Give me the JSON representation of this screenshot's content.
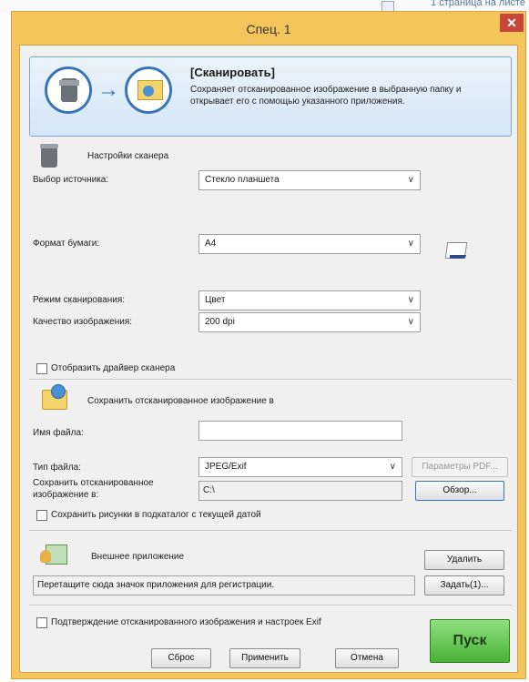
{
  "background": {
    "text": "1 страница на листе"
  },
  "window": {
    "title": "Спец. 1",
    "close_glyph": "✕"
  },
  "banner": {
    "title": "[Сканировать]",
    "description": "Сохраняет отсканированное изображение в выбранную папку и открывает его с помощью указанного приложения.",
    "arrow_glyph": "→"
  },
  "scanner_settings": {
    "section_label": "Настройки сканера",
    "source_label": "Выбор источника:",
    "source_value": "Стекло планшета",
    "paper_label": "Формат бумаги:",
    "paper_value": "A4",
    "mode_label": "Режим сканирования:",
    "mode_value": "Цвет",
    "quality_label": "Качество изображения:",
    "quality_value": "200 dpi",
    "show_driver_label": "Отобразить драйвер сканера"
  },
  "save": {
    "section_label": "Сохранить отсканированное изображение в",
    "filename_label": "Имя файла:",
    "filename_value": "",
    "filetype_label": "Тип файла:",
    "filetype_value": "JPEG/Exif",
    "pdf_params_button": "Параметры PDF...",
    "save_to_label": "Сохранить отсканированное изображение в:",
    "save_to_value": "C:\\",
    "browse_button": "Обзор...",
    "subfolder_label": "Сохранить рисунки в подкаталог с текущей датой"
  },
  "external_app": {
    "section_label": "Внешнее приложение",
    "remove_button": "Удалить",
    "hint": "Перетащите сюда значок приложения для регистрации.",
    "set_button": "Задать(1)..."
  },
  "footer": {
    "confirm_label": "Подтверждение отсканированного изображения и настроек Exif",
    "reset_button": "Сброс",
    "apply_button": "Применить",
    "cancel_button": "Отмена",
    "start_button": "Пуск"
  },
  "icons": {
    "chevron": "∨"
  },
  "colors": {
    "window_frame": "#f3c55a",
    "close": "#c9463d",
    "start": "#48b236",
    "accent": "#3a74b8"
  }
}
